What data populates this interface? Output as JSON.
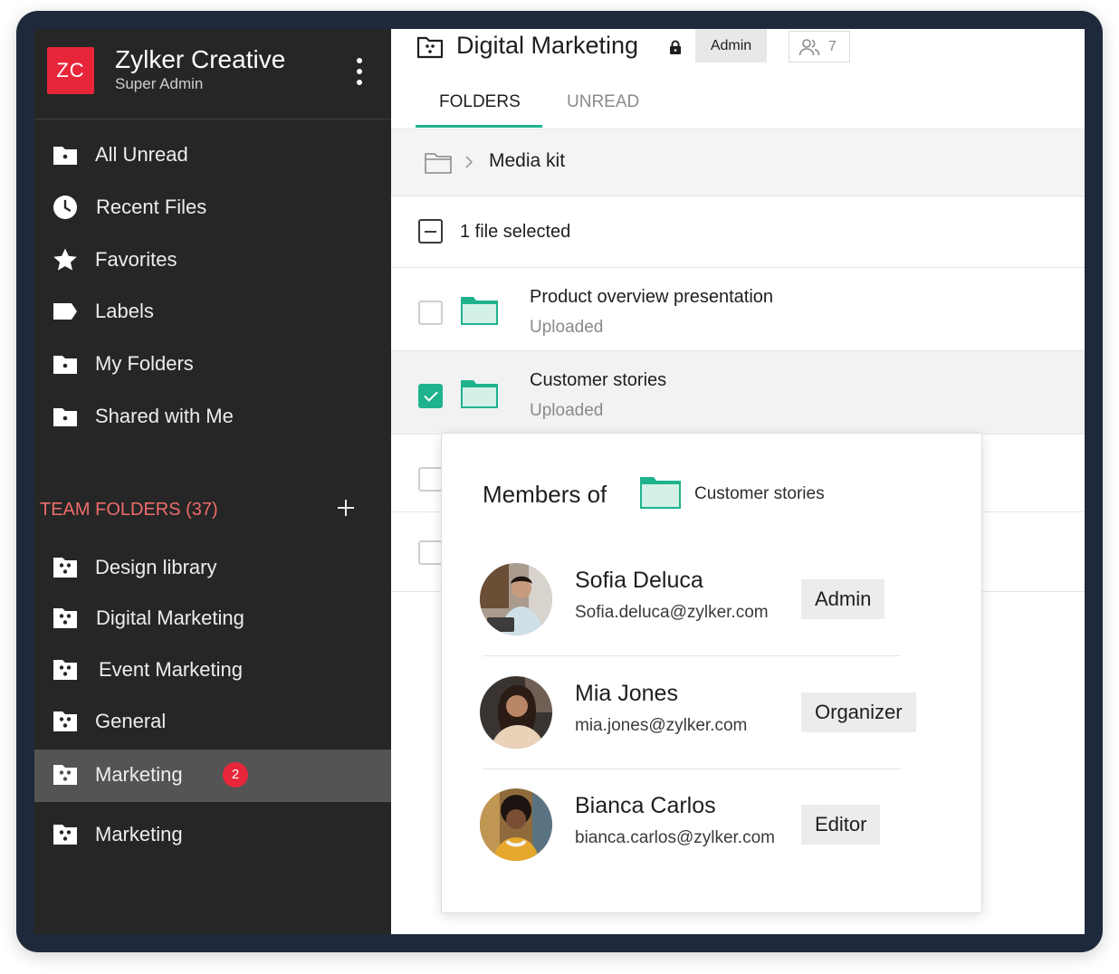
{
  "org": {
    "initials": "ZC",
    "name": "Zylker Creative",
    "role": "Super Admin"
  },
  "sidebar": {
    "items": [
      {
        "label": "All Unread",
        "icon": "folder-icon"
      },
      {
        "label": "Recent Files",
        "icon": "clock-icon"
      },
      {
        "label": "Favorites",
        "icon": "star-icon"
      },
      {
        "label": "Labels",
        "icon": "label-icon"
      },
      {
        "label": "My Folders",
        "icon": "folder-icon"
      },
      {
        "label": "Shared with Me",
        "icon": "folder-icon"
      }
    ],
    "team_header": "TEAM FOLDERS (37)",
    "team_folders": [
      {
        "label": "Design library"
      },
      {
        "label": "Digital Marketing"
      },
      {
        "label": "Event Marketing"
      },
      {
        "label": "General"
      },
      {
        "label": "Marketing",
        "badge": "2",
        "active": true
      },
      {
        "label": "Marketing"
      }
    ]
  },
  "header": {
    "title": "Digital Marketing",
    "role_chip": "Admin",
    "member_count": "7"
  },
  "tabs": [
    {
      "label": "FOLDERS",
      "active": true
    },
    {
      "label": "UNREAD",
      "active": false
    }
  ],
  "breadcrumb": {
    "current": "Media kit"
  },
  "selection": {
    "text": "1 file selected"
  },
  "files": [
    {
      "name": "Product overview presentation",
      "status": "Uploaded",
      "checked": false
    },
    {
      "name": "Customer stories",
      "status": "Uploaded",
      "checked": true
    }
  ],
  "popup": {
    "title": "Members of",
    "folder_name": "Customer stories",
    "members": [
      {
        "name": "Sofia Deluca",
        "email": "Sofia.deluca@zylker.com",
        "role": "Admin"
      },
      {
        "name": "Mia Jones",
        "email": "mia.jones@zylker.com",
        "role": "Organizer"
      },
      {
        "name": "Bianca Carlos",
        "email": "bianca.carlos@zylker.com",
        "role": "Editor"
      }
    ]
  },
  "colors": {
    "accent": "#1fb38d",
    "brand": "#e8263a",
    "sidebar_bg": "#262626",
    "frame": "#1e2a3b"
  }
}
